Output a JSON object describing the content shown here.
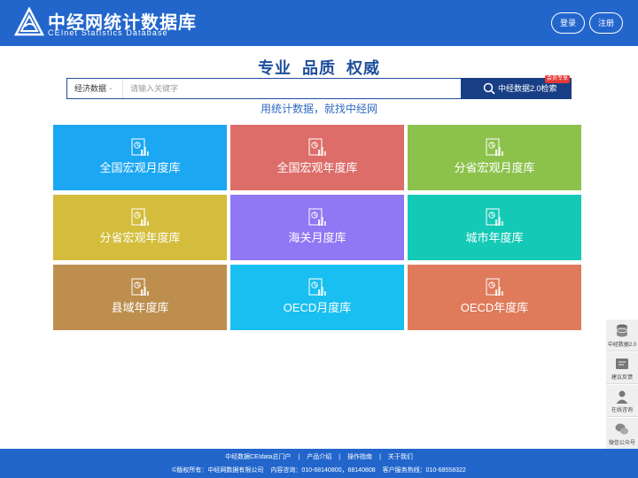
{
  "header": {
    "logo_cn": "中经网统计数据库",
    "logo_en": "CEInet Statistics Database",
    "login_label": "登录",
    "register_label": "注册",
    "bg_color": "#2266cc"
  },
  "slogan": "专业 品质 权威",
  "search": {
    "category_selected": "经济数据",
    "placeholder": "请输入关键字",
    "button_label": "中经数据2.0检索",
    "badge": "会员专享"
  },
  "tagline": "用统计数据，就找中经网",
  "tiles": [
    {
      "label": "全国宏观月度库",
      "color": "#1ba7f2",
      "icon": "chart-doc-icon"
    },
    {
      "label": "全国宏观年度库",
      "color": "#dd6d69",
      "icon": "chart-doc-icon"
    },
    {
      "label": "分省宏观月度库",
      "color": "#8cc24c",
      "icon": "chart-doc-icon"
    },
    {
      "label": "分省宏观年度库",
      "color": "#d4bd3c",
      "icon": "chart-doc-icon"
    },
    {
      "label": "海关月度库",
      "color": "#9077f4",
      "icon": "chart-doc-icon"
    },
    {
      "label": "城市年度库",
      "color": "#14c9b6",
      "icon": "chart-doc-icon"
    },
    {
      "label": "县域年度库",
      "color": "#bd8e4e",
      "icon": "chart-doc-icon"
    },
    {
      "label": "OECD月度库",
      "color": "#19bff0",
      "icon": "chart-doc-icon"
    },
    {
      "label": "OECD年度库",
      "color": "#df7a5a",
      "icon": "chart-doc-icon"
    }
  ],
  "sidebar": [
    {
      "label": "中经数据2.0",
      "icon": "database-icon"
    },
    {
      "label": "建议反馈",
      "icon": "feedback-icon"
    },
    {
      "label": "在线咨询",
      "icon": "support-icon"
    },
    {
      "label": "微信公众号",
      "icon": "wechat-icon"
    }
  ],
  "footer": {
    "links": [
      "中经数据CEIdata总门户",
      "产品介绍",
      "操作指南",
      "关于我们"
    ],
    "copyright": "©版权所有：中经网数据有限公司",
    "consult": "内容咨询：010-68140800，68140808",
    "hotline": "客户服务热线：010-68558322"
  }
}
